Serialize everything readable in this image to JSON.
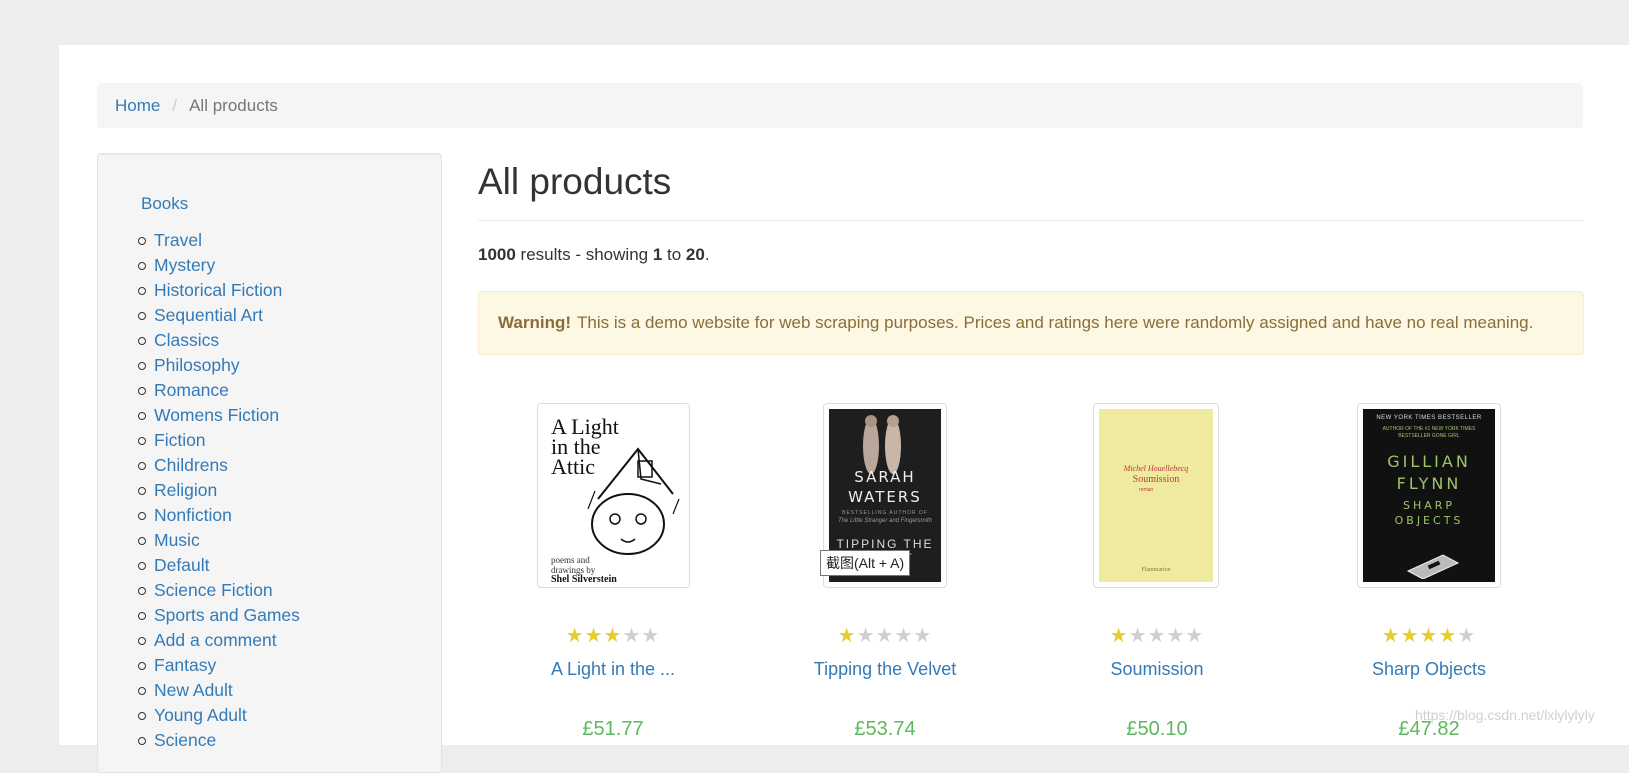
{
  "breadcrumb": {
    "home": "Home",
    "separator": "/",
    "current": "All products"
  },
  "sidebar": {
    "root": "Books",
    "categories": [
      "Travel",
      "Mystery",
      "Historical Fiction",
      "Sequential Art",
      "Classics",
      "Philosophy",
      "Romance",
      "Womens Fiction",
      "Fiction",
      "Childrens",
      "Religion",
      "Nonfiction",
      "Music",
      "Default",
      "Science Fiction",
      "Sports and Games",
      "Add a comment",
      "Fantasy",
      "New Adult",
      "Young Adult",
      "Science"
    ]
  },
  "main": {
    "title": "All products",
    "results": {
      "total": "1000",
      "text1": " results - showing ",
      "from": "1",
      "text2": " to ",
      "to": "20",
      "end": "."
    },
    "alert": {
      "strong": "Warning!",
      "text": "This is a demo website for web scraping purposes. Prices and ratings here were randomly assigned and have no real meaning."
    }
  },
  "products": [
    {
      "title": "A Light in the ...",
      "rating": 3,
      "price": "£51.77",
      "cover": {
        "lines": [
          "A Light",
          "in the",
          "Attic"
        ],
        "sub": "poems and drawings by",
        "author": "Shel Silverstein"
      }
    },
    {
      "title": "Tipping the Velvet",
      "rating": 1,
      "price": "£53.74",
      "cover": {
        "author": "SARAH WATERS",
        "tag": "BESTSELLING AUTHOR OF",
        "sub": "The Little Stranger and Fingersmith",
        "title": "TIPPING THE VELVET"
      }
    },
    {
      "title": "Soumission",
      "rating": 1,
      "price": "£50.10",
      "cover": {
        "author": "Michel Houellebecq",
        "title": "Soumission",
        "tag": "roman",
        "publisher": "Flammarion"
      }
    },
    {
      "title": "Sharp Objects",
      "rating": 4,
      "price": "£47.82",
      "cover": {
        "tag": "NEW YORK TIMES BESTSELLER",
        "sub": "AUTHOR OF THE #1 NEW YORK TIMES BESTSELLER GONE GIRL",
        "author": "GILLIAN FLYNN",
        "title": "SHARP OBJECTS"
      }
    }
  ],
  "tooltip": "截图(Alt + A)",
  "watermark": "https://blog.csdn.net/lxlylylyly",
  "colors": {
    "star_on": "#e6ce31",
    "star_off": "#cfcfcf",
    "price": "#5cb85c",
    "link": "#337ab7"
  }
}
